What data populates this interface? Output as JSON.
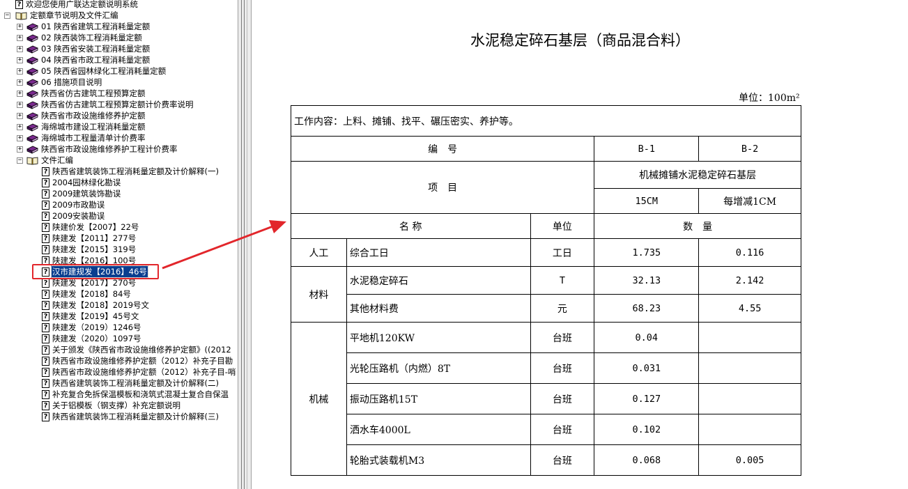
{
  "tree": {
    "items": [
      {
        "label": "欢迎您使用广联达定额说明系统",
        "icon": "help-icon",
        "depth": 0,
        "toggle": "none"
      },
      {
        "label": "定额章节说明及文件汇编",
        "icon": "open-book-icon",
        "depth": 0,
        "toggle": "minus"
      },
      {
        "label": "01 陕西省建筑工程消耗量定额",
        "icon": "book-stack-icon",
        "depth": 1,
        "toggle": "plus"
      },
      {
        "label": "02 陕西装饰工程消耗量定额",
        "icon": "book-stack-icon",
        "depth": 1,
        "toggle": "plus"
      },
      {
        "label": "03 陕西省安装工程消耗量定额",
        "icon": "book-stack-icon",
        "depth": 1,
        "toggle": "plus"
      },
      {
        "label": "04 陕西省市政工程消耗量定额",
        "icon": "book-stack-icon",
        "depth": 1,
        "toggle": "plus"
      },
      {
        "label": "05 陕西省园林绿化工程消耗量定额",
        "icon": "book-stack-icon",
        "depth": 1,
        "toggle": "plus"
      },
      {
        "label": "06 措施项目说明",
        "icon": "book-stack-icon",
        "depth": 1,
        "toggle": "plus"
      },
      {
        "label": "陕西省仿古建筑工程预算定额",
        "icon": "book-stack-icon",
        "depth": 1,
        "toggle": "plus"
      },
      {
        "label": "陕西省仿古建筑工程预算定额计价费率说明",
        "icon": "book-stack-icon",
        "depth": 1,
        "toggle": "plus"
      },
      {
        "label": "陕西省市政设施维修养护定额",
        "icon": "book-stack-icon",
        "depth": 1,
        "toggle": "plus"
      },
      {
        "label": "海绵城市建设工程消耗量定额",
        "icon": "book-stack-icon",
        "depth": 1,
        "toggle": "plus"
      },
      {
        "label": "海绵城市工程量清单计价费率",
        "icon": "book-stack-icon",
        "depth": 1,
        "toggle": "plus"
      },
      {
        "label": "陕西省市政设施维修养护工程计价费率",
        "icon": "book-stack-icon",
        "depth": 1,
        "toggle": "plus"
      },
      {
        "label": "文件汇编",
        "icon": "open-book-icon",
        "depth": 1,
        "toggle": "minus"
      },
      {
        "label": "陕西省建筑装饰工程消耗量定额及计价解释(一)",
        "icon": "help-icon",
        "depth": 2,
        "toggle": "none"
      },
      {
        "label": "2004园林绿化勘误",
        "icon": "help-icon",
        "depth": 2,
        "toggle": "none"
      },
      {
        "label": "2009建筑装饰勘误",
        "icon": "help-icon",
        "depth": 2,
        "toggle": "none"
      },
      {
        "label": "2009市政勘误",
        "icon": "help-icon",
        "depth": 2,
        "toggle": "none"
      },
      {
        "label": "2009安装勘误",
        "icon": "help-icon",
        "depth": 2,
        "toggle": "none"
      },
      {
        "label": "陕建价发【2007】22号",
        "icon": "help-icon",
        "depth": 2,
        "toggle": "none"
      },
      {
        "label": "陕建发【2011】277号",
        "icon": "help-icon",
        "depth": 2,
        "toggle": "none"
      },
      {
        "label": "陕建发【2015】319号",
        "icon": "help-icon",
        "depth": 2,
        "toggle": "none"
      },
      {
        "label": "陕建发【2016】100号",
        "icon": "help-icon",
        "depth": 2,
        "toggle": "none"
      },
      {
        "label": "汉市建规发【2016】46号",
        "icon": "help-icon",
        "depth": 2,
        "toggle": "none",
        "selected": true
      },
      {
        "label": "陕建发【2017】270号",
        "icon": "help-icon",
        "depth": 2,
        "toggle": "none"
      },
      {
        "label": "陕建发【2018】84号",
        "icon": "help-icon",
        "depth": 2,
        "toggle": "none"
      },
      {
        "label": "陕建发【2018】2019号文",
        "icon": "help-icon",
        "depth": 2,
        "toggle": "none"
      },
      {
        "label": "陕建发【2019】45号文",
        "icon": "help-icon",
        "depth": 2,
        "toggle": "none"
      },
      {
        "label": "陕建发（2019）1246号",
        "icon": "help-icon",
        "depth": 2,
        "toggle": "none"
      },
      {
        "label": "陕建发（2020）1097号",
        "icon": "help-icon",
        "depth": 2,
        "toggle": "none"
      },
      {
        "label": "关于颁发《陕西省市政设施维修养护定额》((2012",
        "icon": "help-icon",
        "depth": 2,
        "toggle": "none"
      },
      {
        "label": "陕西省市政设施维修养护定额（2012）补充子目勘",
        "icon": "help-icon",
        "depth": 2,
        "toggle": "none"
      },
      {
        "label": "陕西省市政设施维修养护定额（2012）补充子目-哨",
        "icon": "help-icon",
        "depth": 2,
        "toggle": "none"
      },
      {
        "label": "陕西省建筑装饰工程消耗量定额及计价解释(二)",
        "icon": "help-icon",
        "depth": 2,
        "toggle": "none"
      },
      {
        "label": "补充复合免拆保温模板和浇筑式混凝土复合自保温",
        "icon": "help-icon",
        "depth": 2,
        "toggle": "none"
      },
      {
        "label": "关于铝模板（钢支撑）补充定额说明",
        "icon": "help-icon",
        "depth": 2,
        "toggle": "none"
      },
      {
        "label": "陕西省建筑装饰工程消耗量定额及计价解释(三)",
        "icon": "help-icon",
        "depth": 2,
        "toggle": "none"
      }
    ]
  },
  "doc": {
    "title": "水泥稳定碎石基层（商品混合料）",
    "unit_label": "单位：100m²",
    "work_content": "工作内容：上料、摊铺、找平、碾压密实、养护等。",
    "hdr": {
      "code_label": "编　号",
      "code1": "B-1",
      "code2": "B-2",
      "item_label": "项　目",
      "item_name": "机械摊铺水泥稳定碎石基层",
      "spec1": "15CM",
      "spec2": "每增减1CM",
      "name_label": "名 称",
      "unit_col_label": "单位",
      "qty_label": "数　量"
    },
    "cat_labor": "人工",
    "cat_material": "材料",
    "cat_machine": "机械",
    "rows": [
      {
        "name": "综合工日",
        "unit": "工日",
        "v1": "1.735",
        "v2": "0.116"
      },
      {
        "name": "水泥稳定碎石",
        "unit": "T",
        "v1": "32.13",
        "v2": "2.142"
      },
      {
        "name": "其他材料费",
        "unit": "元",
        "v1": "68.23",
        "v2": "4.55"
      },
      {
        "name": "平地机120KW",
        "unit": "台班",
        "v1": "0.04",
        "v2": ""
      },
      {
        "name": "光轮压路机（内燃）8T",
        "unit": "台班",
        "v1": "0.031",
        "v2": ""
      },
      {
        "name": "振动压路机15T",
        "unit": "台班",
        "v1": "0.127",
        "v2": ""
      },
      {
        "name": "洒水车4000L",
        "unit": "台班",
        "v1": "0.102",
        "v2": ""
      },
      {
        "name": "轮胎式装载机M3",
        "unit": "台班",
        "v1": "0.068",
        "v2": "0.005"
      }
    ]
  },
  "colors": {
    "selection": "#0a3e8f",
    "annotation": "#e2262b",
    "book_icon": "#7a2a8e"
  }
}
